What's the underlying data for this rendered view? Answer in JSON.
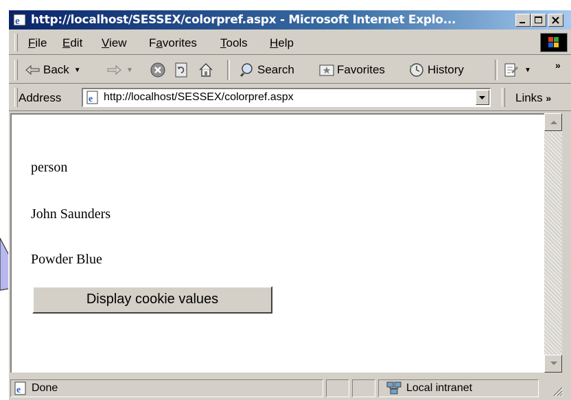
{
  "window": {
    "title": "http://localhost/SESSEX/colorpref.aspx - Microsoft Internet Explo..."
  },
  "menu": [
    {
      "pre": "",
      "key": "F",
      "post": "ile"
    },
    {
      "pre": "",
      "key": "E",
      "post": "dit"
    },
    {
      "pre": "",
      "key": "V",
      "post": "iew"
    },
    {
      "pre": "F",
      "key": "a",
      "post": "vorites"
    },
    {
      "pre": "",
      "key": "T",
      "post": "ools"
    },
    {
      "pre": "",
      "key": "H",
      "post": "elp"
    }
  ],
  "toolbar": {
    "back": "Back",
    "search": "Search",
    "favorites": "Favorites",
    "history": "History"
  },
  "address": {
    "label": "Address",
    "url": "http://localhost/SESSEX/colorpref.aspx",
    "links": "Links"
  },
  "page": {
    "line1": "person",
    "line2": "John Saunders",
    "line3": "Powder Blue",
    "button": "Display cookie values"
  },
  "status": {
    "text": "Done",
    "zone": "Local intranet"
  }
}
